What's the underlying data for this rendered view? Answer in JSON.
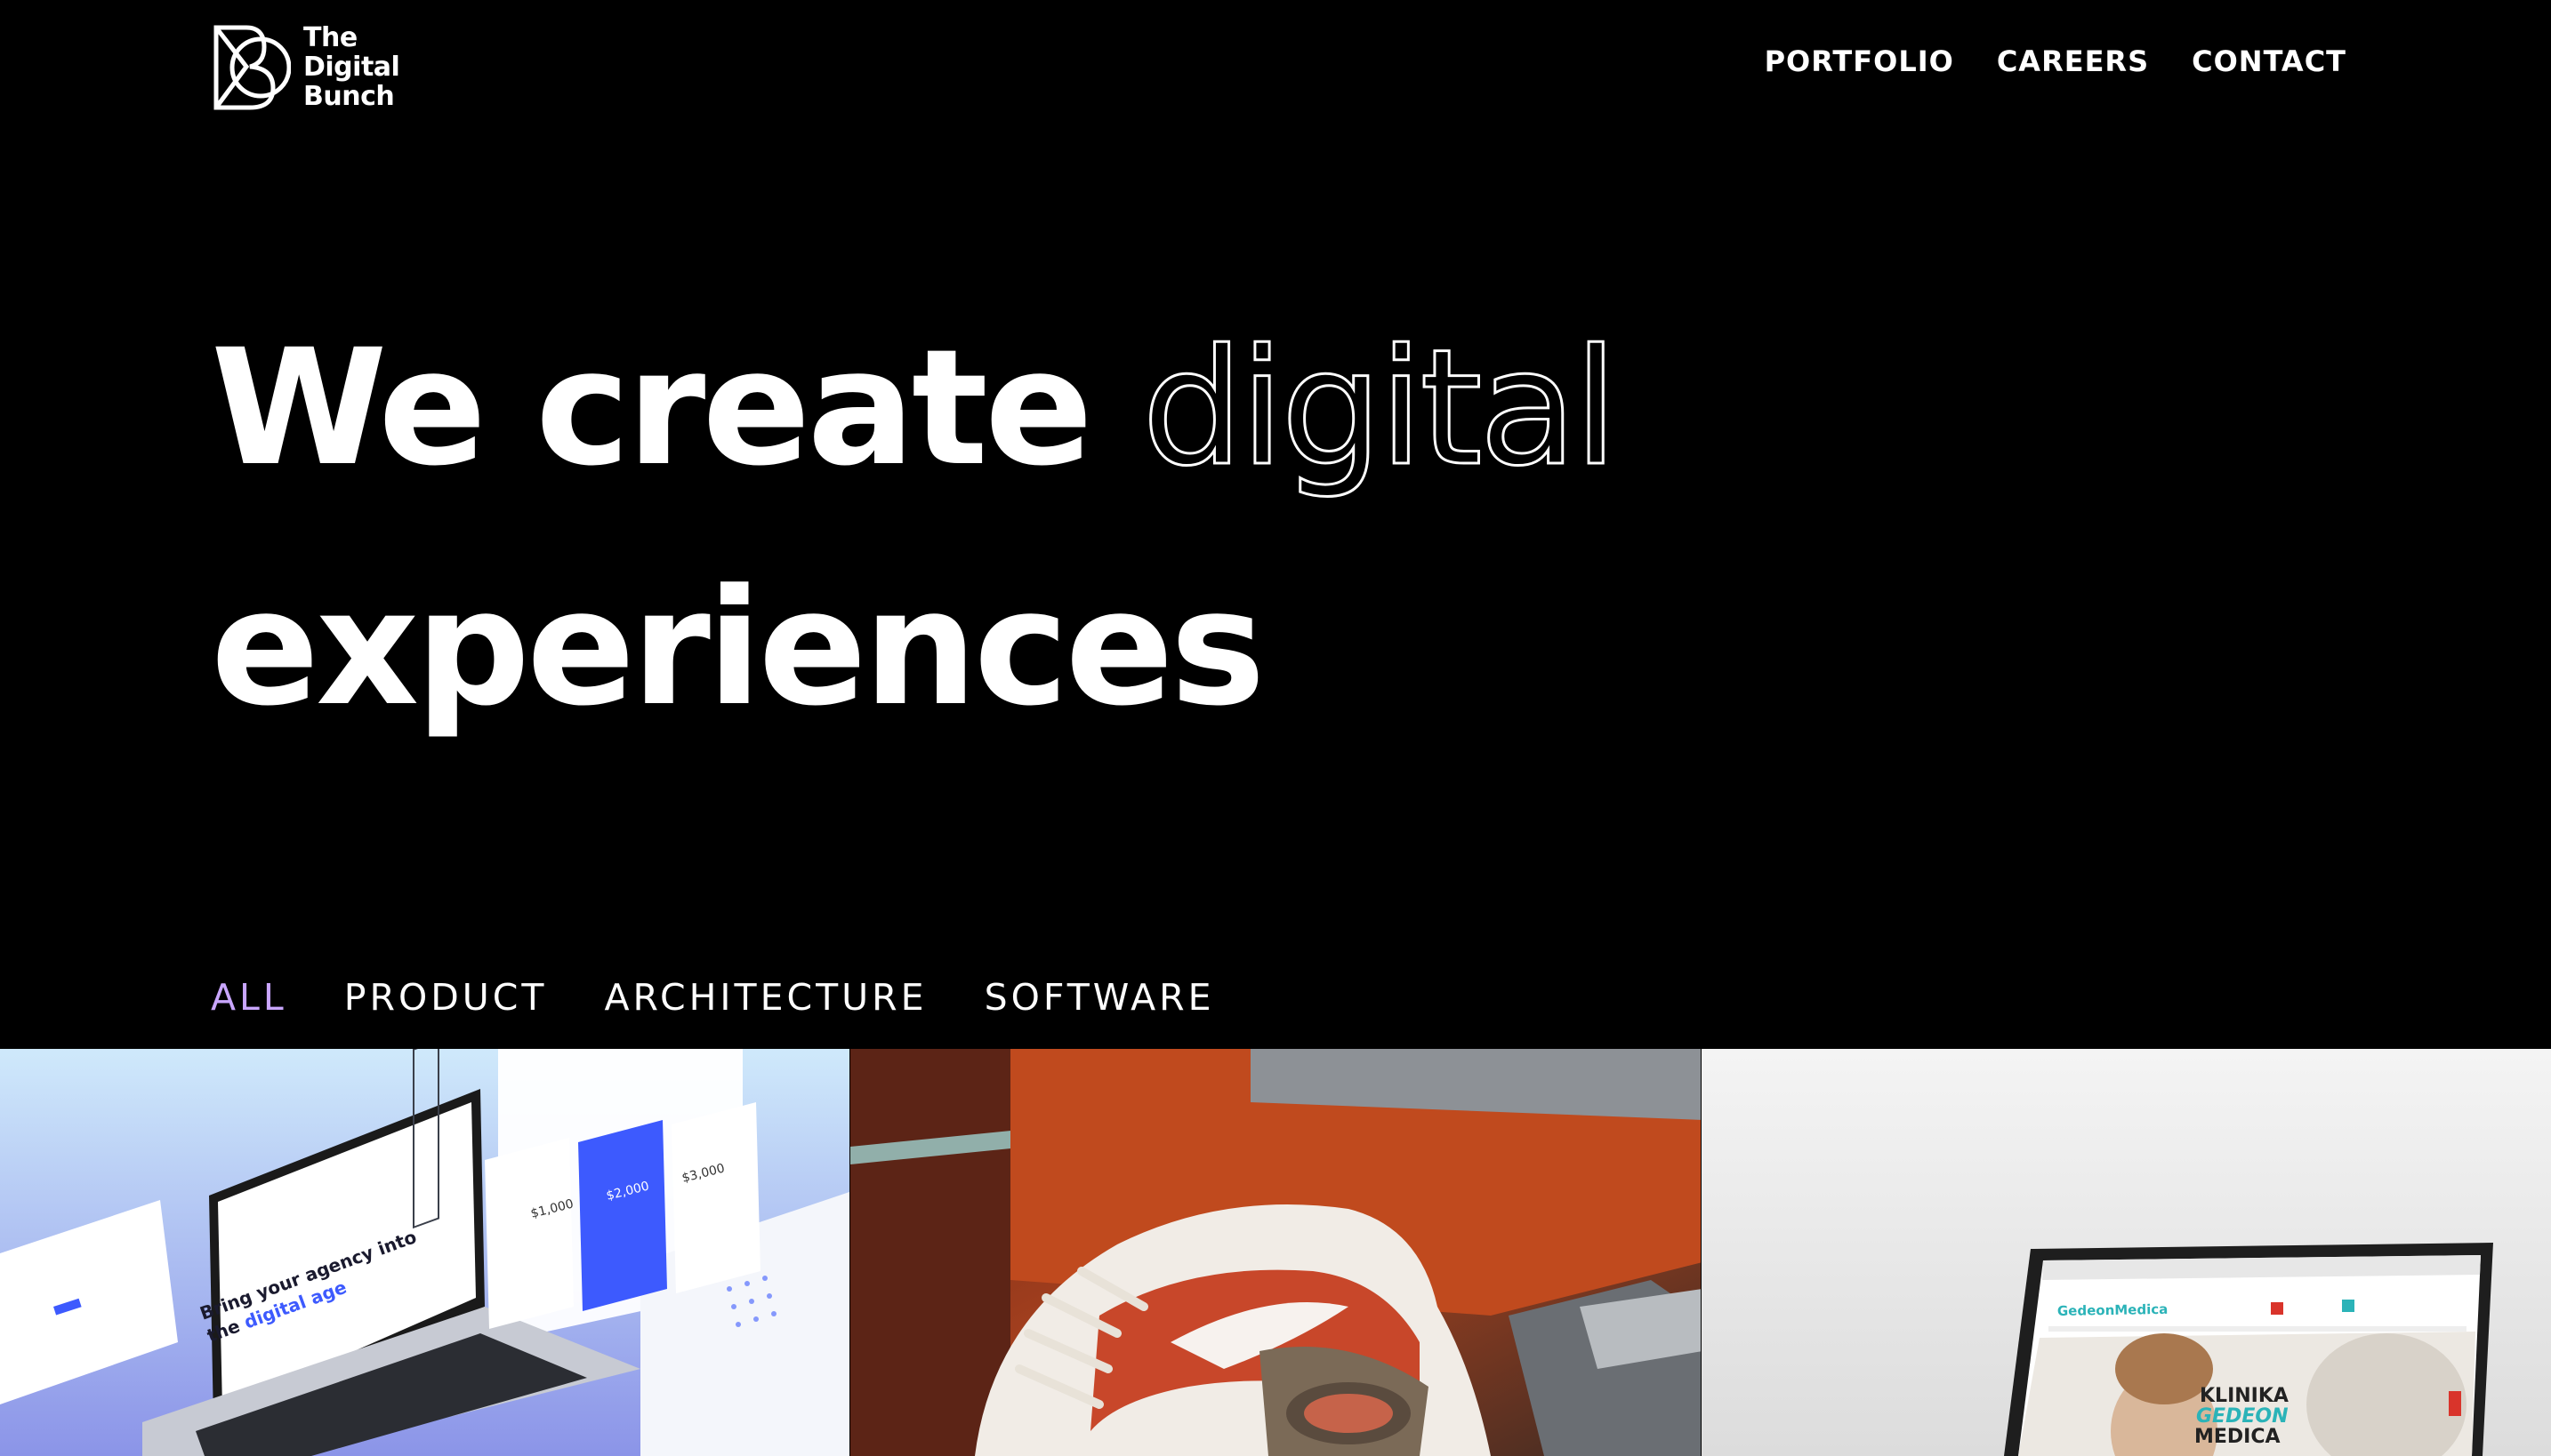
{
  "brand": {
    "line1": "The",
    "line2": "Digital",
    "line3": "Bunch"
  },
  "nav": {
    "items": [
      {
        "label": "PORTFOLIO"
      },
      {
        "label": "CAREERS"
      },
      {
        "label": "CONTACT"
      }
    ]
  },
  "hero": {
    "part1": "We create ",
    "part2": "digital",
    "part3": "experiences"
  },
  "filters": [
    {
      "label": "ALL",
      "active": true
    },
    {
      "label": "PRODUCT"
    },
    {
      "label": "ARCHITECTURE"
    },
    {
      "label": "SOFTWARE"
    }
  ],
  "tiles": [
    {
      "headline1": "Bring your agency into",
      "headline2": "the ",
      "headline_accent": "digital age",
      "card_price_a": "$1,000",
      "card_price_b": "$2,000",
      "card_price_c": "$3,000"
    },
    {},
    {
      "brand": "GedeonMedica",
      "line1": "KLINIKA",
      "line2": "GEDEON",
      "line3": "MEDICA"
    }
  ],
  "colors": {
    "accent": "#c9a6ff",
    "background": "#000000",
    "text": "#ffffff"
  }
}
